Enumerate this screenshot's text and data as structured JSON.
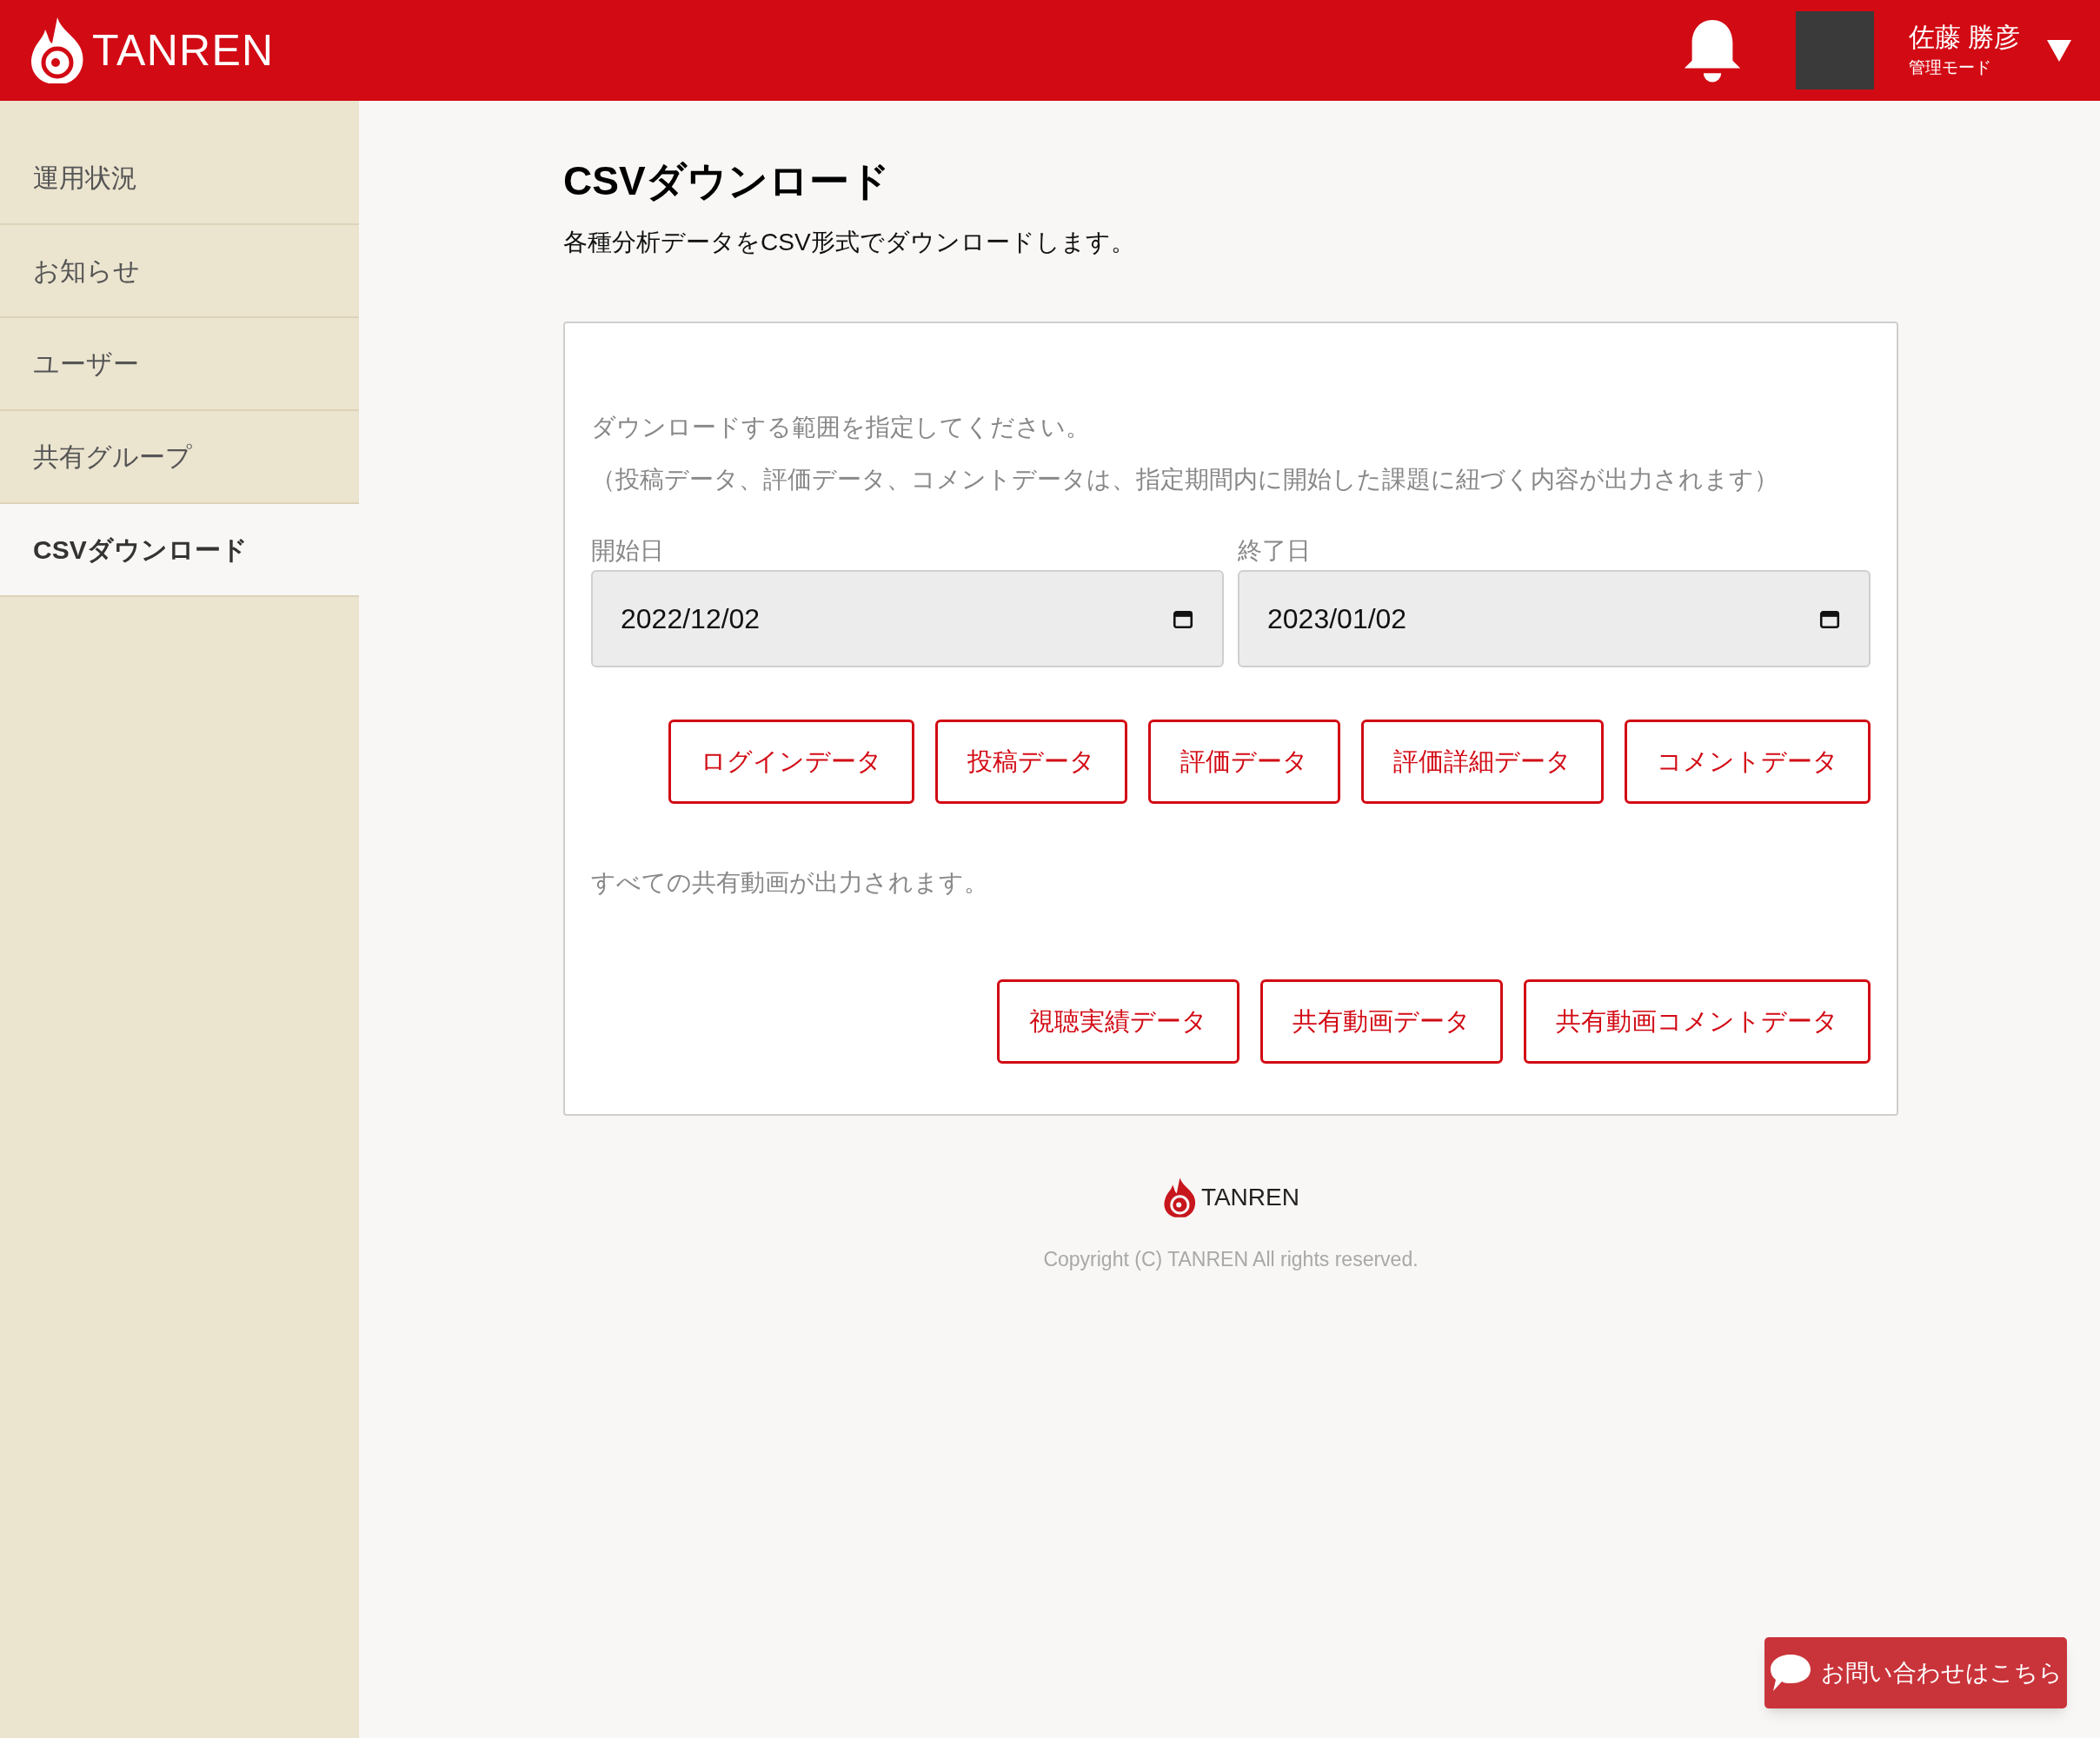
{
  "header": {
    "logo": "TANREN",
    "user": {
      "name": "佐藤 勝彦",
      "role": "管理モード"
    }
  },
  "sidebar": {
    "items": [
      {
        "label": "運用状況",
        "selected": false
      },
      {
        "label": "お知らせ",
        "selected": false
      },
      {
        "label": "ユーザー",
        "selected": false
      },
      {
        "label": "共有グループ",
        "selected": false
      },
      {
        "label": "CSVダウンロード",
        "selected": true
      }
    ]
  },
  "page": {
    "title": "CSVダウンロード",
    "description": "各種分析データをCSV形式でダウンロードします。"
  },
  "card": {
    "instructions": [
      "ダウンロードする範囲を指定してください。",
      "（投稿データ、評価データ、コメントデータは、指定期間内に開始した課題に紐づく内容が出力されます）"
    ],
    "fields": [
      {
        "label": "開始日",
        "value": "2022/12/02"
      },
      {
        "label": "終了日",
        "value": "2023/01/02"
      }
    ],
    "period_buttons": [
      "ログインデータ",
      "投稿データ",
      "評価データ",
      "評価詳細データ",
      "コメントデータ"
    ],
    "note": "すべての共有動画が出力されます。",
    "video_buttons": [
      "視聴実績データ",
      "共有動画データ",
      "共有動画コメントデータ"
    ]
  },
  "footer": {
    "logo": "TANREN",
    "copyright": "Copyright (C) TANREN All rights reserved."
  },
  "contact_button": "お問い合わせはこちら"
}
